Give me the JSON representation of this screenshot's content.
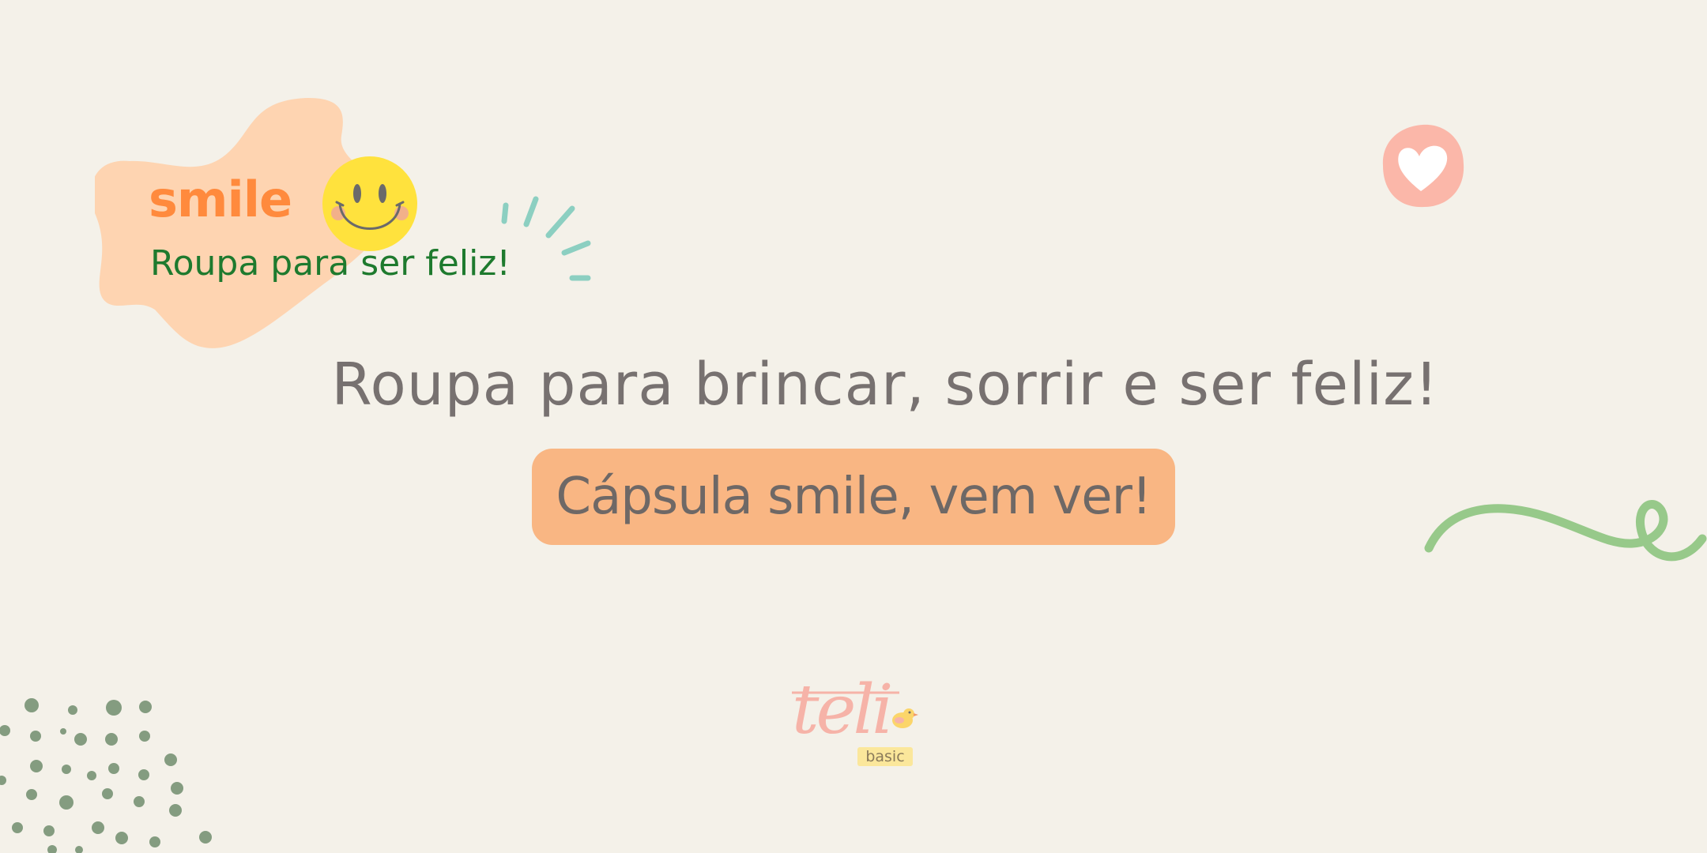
{
  "badge": {
    "brand": "smile",
    "tagline": "Roupa para ser feliz!"
  },
  "headline": "Roupa para brincar, sorrir e ser feliz!",
  "cta": {
    "label": "Cápsula smile, vem ver!"
  },
  "logo": {
    "word": "teli",
    "tag": "basic"
  },
  "icons": {
    "smiley": "smiley-face-icon",
    "heart": "heart-icon",
    "sparkle": "sparkle-lines-icon",
    "squiggle": "squiggle-line-decoration",
    "dots": "dot-pattern-decoration",
    "bird": "bird-icon"
  },
  "colors": {
    "background": "#f4f1e9",
    "blob": "#fed4b1",
    "brand_orange": "#ff8a3d",
    "tagline_green": "#1e7a2e",
    "smiley_yellow": "#ffe23d",
    "heart_pink": "#fbb7a9",
    "sparkle_teal": "#8ccfc1",
    "headline_gray": "#777170",
    "cta_background": "#f9b683",
    "squiggle_green": "#97c98a",
    "dots_green": "#849c80",
    "logo_pink": "#f6b3a8",
    "logo_tag_yellow": "#fbe79b"
  }
}
